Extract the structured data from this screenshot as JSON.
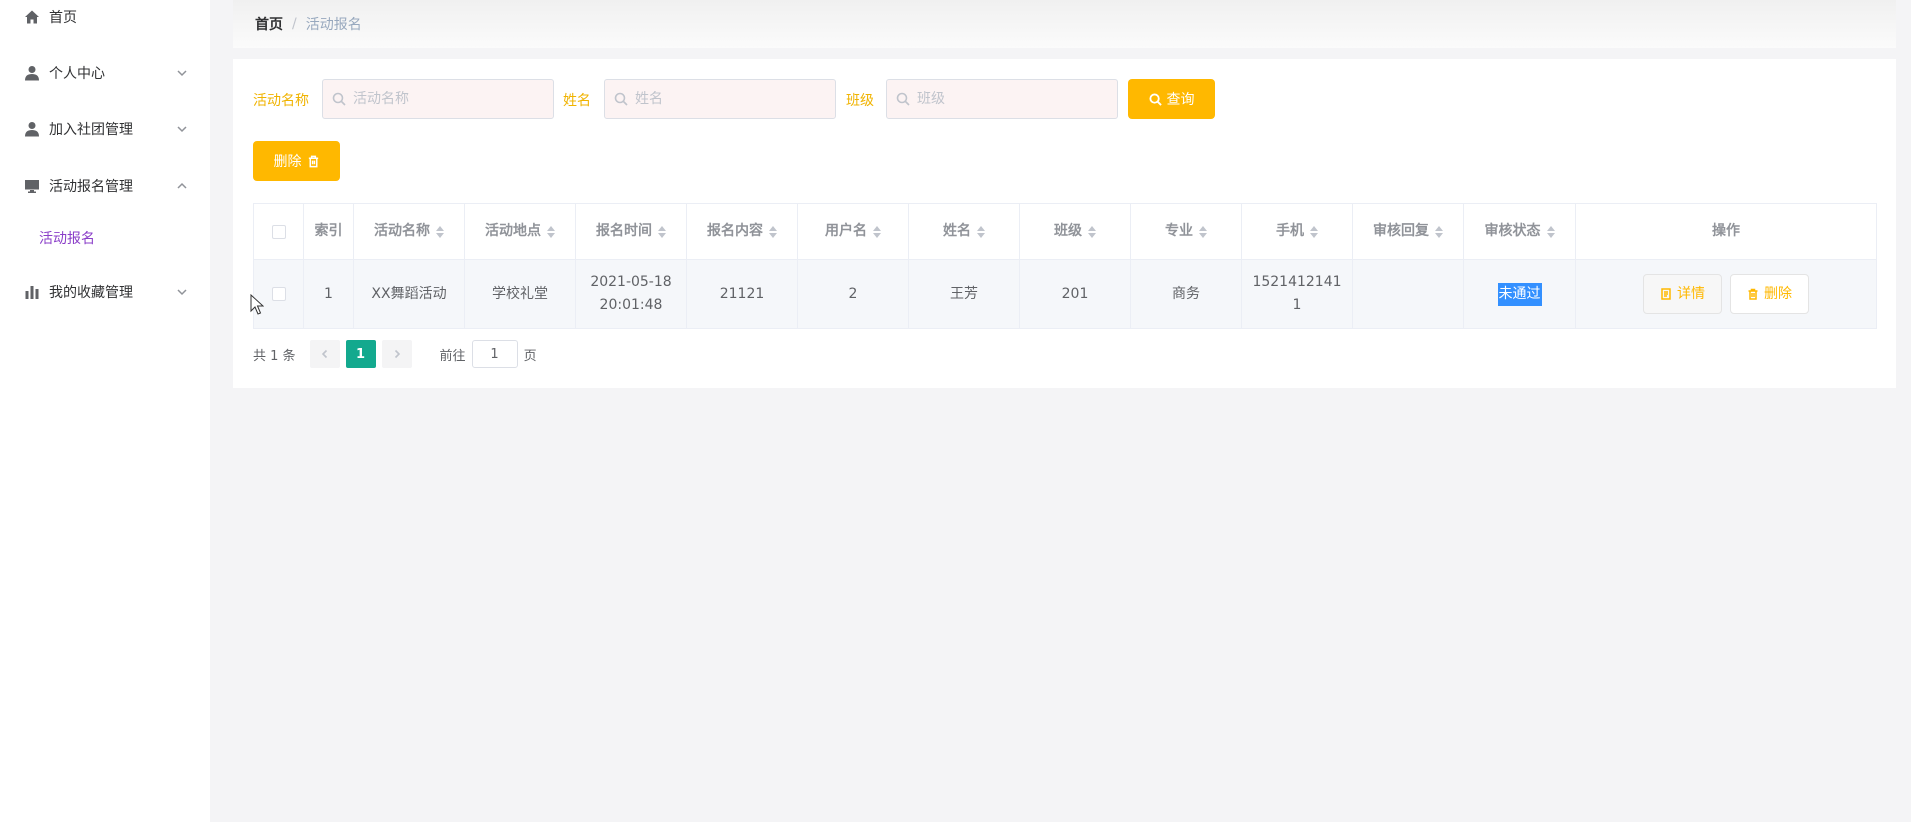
{
  "sidebar": {
    "items": [
      {
        "label": "首页",
        "icon": "home-icon"
      },
      {
        "label": "个人中心",
        "icon": "user-icon"
      },
      {
        "label": "加入社团管理",
        "icon": "user-icon"
      },
      {
        "label": "活动报名管理",
        "icon": "monitor-icon"
      },
      {
        "label": "我的收藏管理",
        "icon": "bar-chart-icon"
      }
    ],
    "submenu": {
      "label": "活动报名"
    }
  },
  "breadcrumb": {
    "home": "首页",
    "separator": "/",
    "current": "活动报名"
  },
  "search": {
    "activity_label": "活动名称",
    "activity_placeholder": "活动名称",
    "name_label": "姓名",
    "name_placeholder": "姓名",
    "class_label": "班级",
    "class_placeholder": "班级",
    "query_button": "查询"
  },
  "toolbar": {
    "delete_label": "删除"
  },
  "table": {
    "headers": [
      "索引",
      "活动名称",
      "活动地点",
      "报名时间",
      "报名内容",
      "用户名",
      "姓名",
      "班级",
      "专业",
      "手机",
      "审核回复",
      "审核状态",
      "操作"
    ],
    "rows": [
      {
        "index": "1",
        "activity": "XX舞蹈活动",
        "location": "学校礼堂",
        "time_date": "2021-05-18",
        "time_clock": "20:01:48",
        "content": "21121",
        "username": "2",
        "name": "王芳",
        "class": "201",
        "major": "商务",
        "phone_1": "1521412141",
        "phone_2": "1",
        "reply": "",
        "status": "未通过",
        "detail_label": "详情",
        "delete_label": "删除"
      }
    ]
  },
  "pagination": {
    "total": "共 1 条",
    "current_page": "1",
    "goto_label": "前往",
    "goto_value": "1",
    "page_unit": "页"
  },
  "colors": {
    "accent": "#ffb800",
    "active_page": "#13a98e",
    "submenu_active": "#8a3ec8",
    "selection": "#3390ff"
  }
}
